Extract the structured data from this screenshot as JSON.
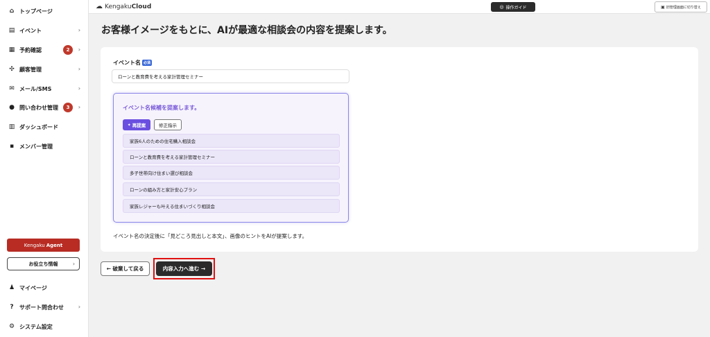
{
  "sidebar": {
    "items": [
      {
        "label": "トップページ",
        "icon": "home-icon",
        "glyph": "⌂"
      },
      {
        "label": "イベント",
        "icon": "document-icon",
        "glyph": "▤",
        "chevron": "›"
      },
      {
        "label": "予約確認",
        "icon": "calendar-icon",
        "glyph": "▦",
        "badge": "2",
        "chevron": "›"
      },
      {
        "label": "顧客管理",
        "icon": "users-icon",
        "glyph": "✣",
        "chevron": "›"
      },
      {
        "label": "メール/SMS",
        "icon": "mail-icon",
        "glyph": "✉",
        "chevron": "›"
      },
      {
        "label": "問い合わせ管理",
        "icon": "chat-icon",
        "glyph": "●",
        "badge": "3",
        "chevron": "›"
      },
      {
        "label": "ダッシュボード",
        "icon": "dashboard-icon",
        "glyph": "▥"
      },
      {
        "label": "メンバー管理",
        "icon": "grid-icon",
        "glyph": "▪"
      }
    ],
    "agent": {
      "prefix": "Kengaku",
      "bold": "Agent"
    },
    "useful_info": "お役立ち情報",
    "bottom_items": [
      {
        "label": "マイページ",
        "icon": "person-icon",
        "glyph": "♟"
      },
      {
        "label": "サポート問合わせ",
        "icon": "help-icon",
        "glyph": "?",
        "chevron": "›"
      },
      {
        "label": "システム設定",
        "icon": "gear-icon",
        "glyph": "⚙"
      }
    ]
  },
  "header": {
    "logo_text": "Kengaku",
    "logo_bold": "Cloud",
    "guide_label": "操作ガイド",
    "switch_label": "旧管理画面に切り替え"
  },
  "main": {
    "page_title": "お客様イメージをもとに、AIが最適な相談会の内容を提案します。",
    "field_label": "イベント名",
    "required_badge": "必須",
    "event_name_value": "ローンと教育費を考える家計管理セミナー",
    "suggest_title": "イベント名候補を提案します。",
    "regen_label": "再提案",
    "fix_label": "修正指示",
    "candidates": [
      "家族6人のための住宅購入相談会",
      "ローンと教育費を考える家計管理セミナー",
      "多子世帯向け住まい選び相談会",
      "ローンの組み方と家計安心プラン",
      "家族レジャーも叶える住まいづくり相談会"
    ],
    "hint_text": "イベント名の決定後に「見どころ見出しと本文」、画像のヒントをAIが提案します。",
    "back_label": "← 破棄して戻る",
    "next_label": "内容入力へ進む →"
  }
}
